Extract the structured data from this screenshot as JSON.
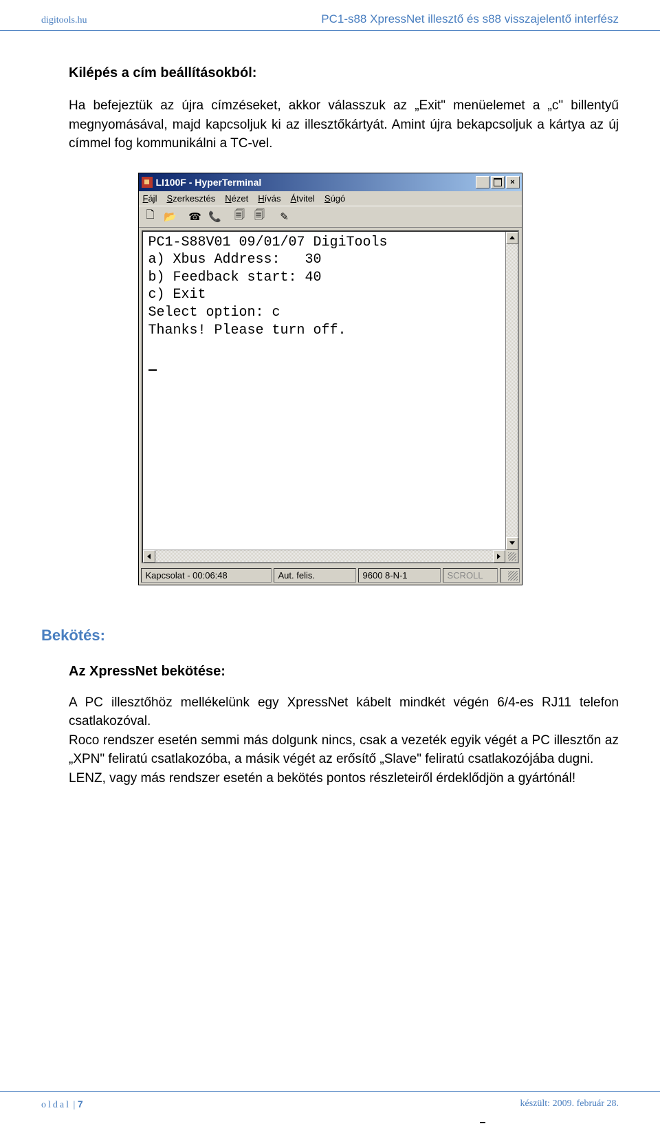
{
  "header": {
    "site": "digitools.hu",
    "title": "PC1-s88 XpressNet illesztő és s88 visszajelentő interfész"
  },
  "section1": {
    "heading": "Kilépés a cím beállításokból:",
    "para": "Ha befejeztük az újra címzéseket, akkor válasszuk az „Exit\" menüelemet a „c\" billentyű megnyomásával, majd kapcsoljuk ki az illesztőkártyát. Amint újra bekapcsoljuk a kártya az új címmel fog kommunikálni a TC-vel."
  },
  "terminal": {
    "title": "LI100F - HyperTerminal",
    "menus": {
      "file": "Fájl",
      "edit": "Szerkesztés",
      "view": "Nézet",
      "call": "Hívás",
      "transfer": "Átvitel",
      "help": "Súgó"
    },
    "lines": {
      "l0": "PC1-S88V01 09/01/07 DigiTools",
      "l1": "",
      "l2": "",
      "l3": "a) Xbus Address:   30",
      "l4": "b) Feedback start: 40",
      "l5": "c) Exit",
      "l6": "",
      "l7": "",
      "l8": "",
      "l9": "Select option: c",
      "l10": "Thanks! Please turn off.",
      "l11": ""
    },
    "status": {
      "conn": "Kapcsolat - 00:06:48",
      "detect": "Aut. felis.",
      "params": "9600 8-N-1",
      "scroll": "SCROLL"
    }
  },
  "section2": {
    "heading": "Bekötés:",
    "subheading": "Az XpressNet bekötése:",
    "para1": "A PC illesztőhöz mellékelünk egy XpressNet kábelt mindkét végén 6/4-es RJ11 telefon csatlakozóval.",
    "para2": "Roco rendszer esetén semmi más dolgunk nincs, csak a vezeték egyik végét a PC illesztőn az „XPN\" feliratú csatlakozóba, a másik végét az erősítő „Slave\" feliratú csatlakozójába dugni.",
    "para3": "LENZ, vagy más rendszer esetén a bekötés pontos részleteiről érdeklődjön a gyártónál!"
  },
  "footer": {
    "label": "oldal",
    "page": "7",
    "date": "készült: 2009. február 28."
  }
}
